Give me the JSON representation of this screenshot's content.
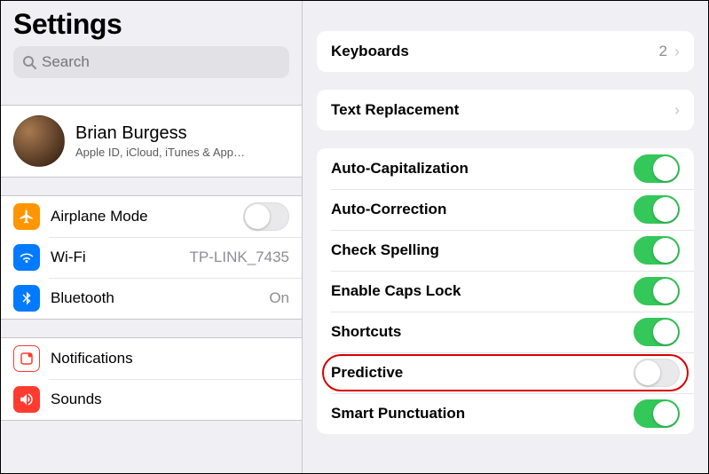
{
  "sidebar": {
    "title": "Settings",
    "search_placeholder": "Search",
    "profile": {
      "name": "Brian Burgess",
      "subtitle": "Apple ID, iCloud, iTunes & App…"
    },
    "network": {
      "airplane": {
        "label": "Airplane Mode",
        "on": false
      },
      "wifi": {
        "label": "Wi-Fi",
        "value": "TP-LINK_7435"
      },
      "bluetooth": {
        "label": "Bluetooth",
        "value": "On"
      }
    },
    "alerts": {
      "notifications": {
        "label": "Notifications"
      },
      "sounds": {
        "label": "Sounds"
      }
    }
  },
  "detail": {
    "keyboards": {
      "label": "Keyboards",
      "count": "2"
    },
    "text_replacement": {
      "label": "Text Replacement"
    },
    "toggles": [
      {
        "key": "auto_cap",
        "label": "Auto-Capitalization",
        "on": true,
        "highlight": false
      },
      {
        "key": "auto_correct",
        "label": "Auto-Correction",
        "on": true,
        "highlight": false
      },
      {
        "key": "check_spelling",
        "label": "Check Spelling",
        "on": true,
        "highlight": false
      },
      {
        "key": "caps_lock",
        "label": "Enable Caps Lock",
        "on": true,
        "highlight": false
      },
      {
        "key": "shortcuts",
        "label": "Shortcuts",
        "on": true,
        "highlight": false
      },
      {
        "key": "predictive",
        "label": "Predictive",
        "on": false,
        "highlight": true
      },
      {
        "key": "smart_punct",
        "label": "Smart Punctuation",
        "on": true,
        "highlight": false
      }
    ]
  }
}
